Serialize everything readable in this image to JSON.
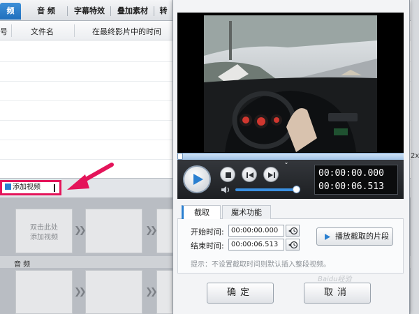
{
  "tabs": [
    {
      "label": "频",
      "active": true
    },
    {
      "label": "音 频",
      "active": false
    },
    {
      "label": "字幕特效",
      "active": false
    },
    {
      "label": "叠加素材",
      "active": false
    },
    {
      "label": "转",
      "active": false
    }
  ],
  "file_list": {
    "columns": [
      "号",
      "文件名",
      "在最终影片中的时间"
    ]
  },
  "add_video_button": "添加视频",
  "timeline": {
    "placeholder_hint": "双击此处\n添加视频",
    "audio_label": "音 频"
  },
  "dialog": {
    "player": {
      "current_time": "00:00:00.000",
      "total_time": "00:00:06.513",
      "progress": 0,
      "volume": 0.95
    },
    "tabs": [
      "截取",
      "魔术功能"
    ],
    "start_label": "开始时间:",
    "start_value": "00:00:00.000",
    "end_label": "结束时间:",
    "end_value": "00:00:06.513",
    "play_clip_button": "播放截取的片段",
    "hint": "提示：不设置截取时间则默认插入整段视频。",
    "ok_button": "确定",
    "cancel_button": "取消"
  },
  "right_edge_text": "2x",
  "watermark": "Baidu经验",
  "colors": {
    "accent_blue": "#2a7fd0",
    "highlight_pink": "#e4145a",
    "dark_panel": "#1d1f22"
  }
}
